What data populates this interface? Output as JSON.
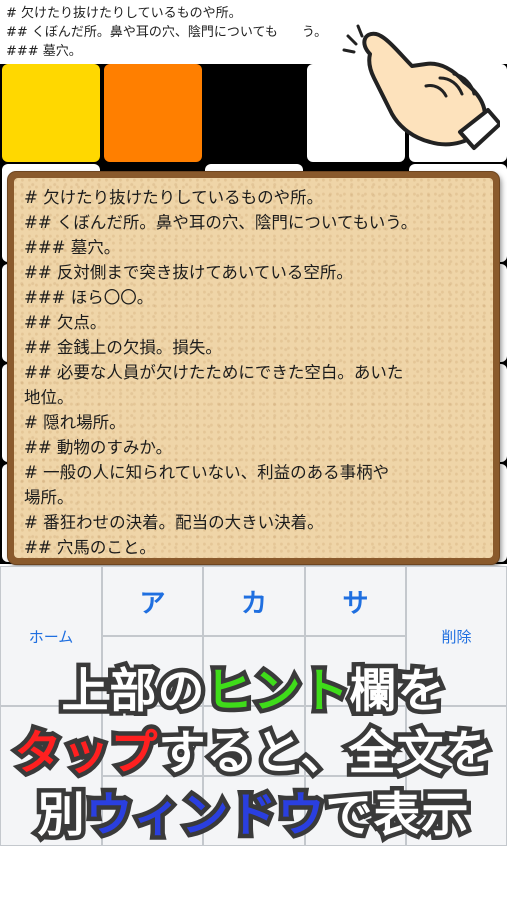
{
  "hint": {
    "lines": [
      "# 欠けたり抜けたりしているものや所。",
      "## くぼんだ所。鼻や耳の穴、陰門についても",
      "### 墓穴。"
    ],
    "line2_tail": "う。"
  },
  "popup": {
    "lines": [
      "# 欠けたり抜けたりしているものや所。",
      "## くぼんだ所。鼻や耳の穴、陰門についてもいう。",
      "### 墓穴。",
      "## 反対側まで突き抜けてあいている空所。",
      "### ほら〇〇。",
      "## 欠点。",
      "## 金銭上の欠損。損失。",
      "## 必要な人員が欠けたためにできた空白。あいた",
      "地位。",
      "# 隠れ場所。",
      "## 動物のすみか。",
      "# 一般の人に知られていない、利益のある事柄や",
      "場所。",
      "# 番狂わせの決着。配当の大きい決着。",
      "## 穴馬のこと。"
    ]
  },
  "keyboard": {
    "home_label": "ホーム",
    "delete_label": "削除",
    "kana": [
      "ア",
      "カ",
      "サ"
    ]
  },
  "caption": {
    "line1": [
      "上部の",
      "ヒント",
      "欄を"
    ],
    "line2": [
      "タップ",
      "すると、全文を"
    ],
    "line3": [
      "別",
      "ウィンドウ",
      "で表示"
    ]
  },
  "colors": {
    "yellow_cell": "#ffd800",
    "orange_cell": "#ff7f00",
    "grid_bg": "#000000",
    "highlight_green": "#3fdc1a",
    "highlight_red": "#ff2020",
    "highlight_blue": "#2a3fe0",
    "caption_white": "#ffffff",
    "key_blue": "#1f6fe0"
  }
}
